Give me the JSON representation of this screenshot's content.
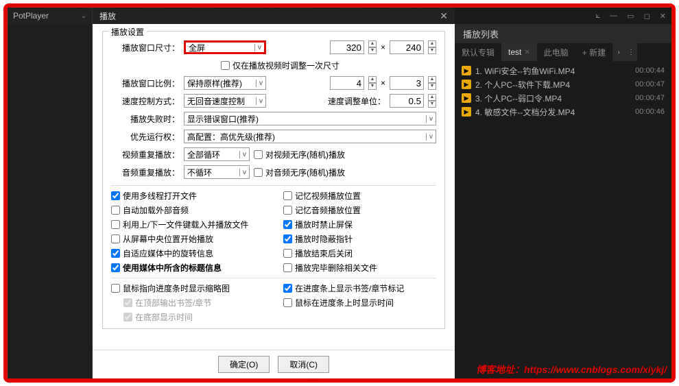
{
  "player": {
    "title": "PotPlayer"
  },
  "dialog": {
    "title": "播放",
    "legend": "播放设置",
    "window_size_label": "播放窗口尺寸：",
    "window_size_value": "全屏",
    "size_w": "320",
    "size_h": "240",
    "only_resize_label": "仅在播放视频时调整一次尺寸",
    "ratio_label": "播放窗口比例：",
    "ratio_value": "保持原样(推荐)",
    "ratio_a": "4",
    "ratio_b": "3",
    "speed_mode_label": "速度控制方式：",
    "speed_mode_value": "无回音速度控制",
    "speed_unit_label": "速度调整单位：",
    "speed_unit_value": "0.5",
    "fail_label": "播放失败时：",
    "fail_value": "显示错误窗口(推荐)",
    "priority_label": "优先运行权：",
    "priority_value": "高配置：高优先级(推荐)",
    "video_repeat_label": "视频重复播放：",
    "video_repeat_value": "全部循环",
    "video_repeat_chk": "对视频无序(随机)播放",
    "audio_repeat_label": "音频重复播放：",
    "audio_repeat_value": "不循环",
    "audio_repeat_chk": "对音频无序(随机)播放",
    "col_left": [
      {
        "label": "使用多线程打开文件",
        "checked": true,
        "bold": false
      },
      {
        "label": "自动加载外部音频",
        "checked": false,
        "bold": false
      },
      {
        "label": "利用上/下一文件键载入并播放文件",
        "checked": false,
        "bold": false
      },
      {
        "label": "从屏幕中央位置开始播放",
        "checked": false,
        "bold": false
      },
      {
        "label": "自适应媒体中的旋转信息",
        "checked": true,
        "bold": false
      },
      {
        "label": "使用媒体中所含的标题信息",
        "checked": true,
        "bold": true
      }
    ],
    "col_right": [
      {
        "label": "记忆视频播放位置",
        "checked": false
      },
      {
        "label": "记忆音频播放位置",
        "checked": false
      },
      {
        "label": "播放时禁止屏保",
        "checked": true
      },
      {
        "label": "播放时隐蔽指针",
        "checked": true
      },
      {
        "label": "播放结束后关闭",
        "checked": false
      },
      {
        "label": "播放完毕删除相关文件",
        "checked": false
      }
    ],
    "bottom_left": [
      {
        "label": "鼠标指向进度条时显示缩略图",
        "checked": false,
        "disabled": false
      },
      {
        "label": "在顶部输出书签/章节",
        "checked": true,
        "disabled": true
      },
      {
        "label": "在底部显示时间",
        "checked": true,
        "disabled": true
      }
    ],
    "bottom_right": [
      {
        "label": "在进度条上显示书签/章节标记",
        "checked": true
      },
      {
        "label": "鼠标在进度条上时显示时间",
        "checked": false
      }
    ],
    "ok": "确定(O)",
    "cancel": "取消(C)"
  },
  "playlist": {
    "title": "播放列表",
    "tabs": [
      {
        "label": "默认专辑",
        "active": false
      },
      {
        "label": "test",
        "active": true,
        "closable": true
      },
      {
        "label": "此电脑",
        "active": false
      },
      {
        "label": "+ 新建",
        "active": false
      }
    ],
    "items": [
      {
        "n": "1",
        "name": "WiFi安全--钓鱼WiFi.MP4",
        "dur": "00:00:44"
      },
      {
        "n": "2",
        "name": "个人PC--软件下载.MP4",
        "dur": "00:00:47"
      },
      {
        "n": "3",
        "name": "个人PC--弱口令.MP4",
        "dur": "00:00:47"
      },
      {
        "n": "4",
        "name": "敏感文件--文档分发.MP4",
        "dur": "00:00:46"
      }
    ]
  },
  "blog": "博客地址：https://www.cnblogs.com/xiykj/"
}
